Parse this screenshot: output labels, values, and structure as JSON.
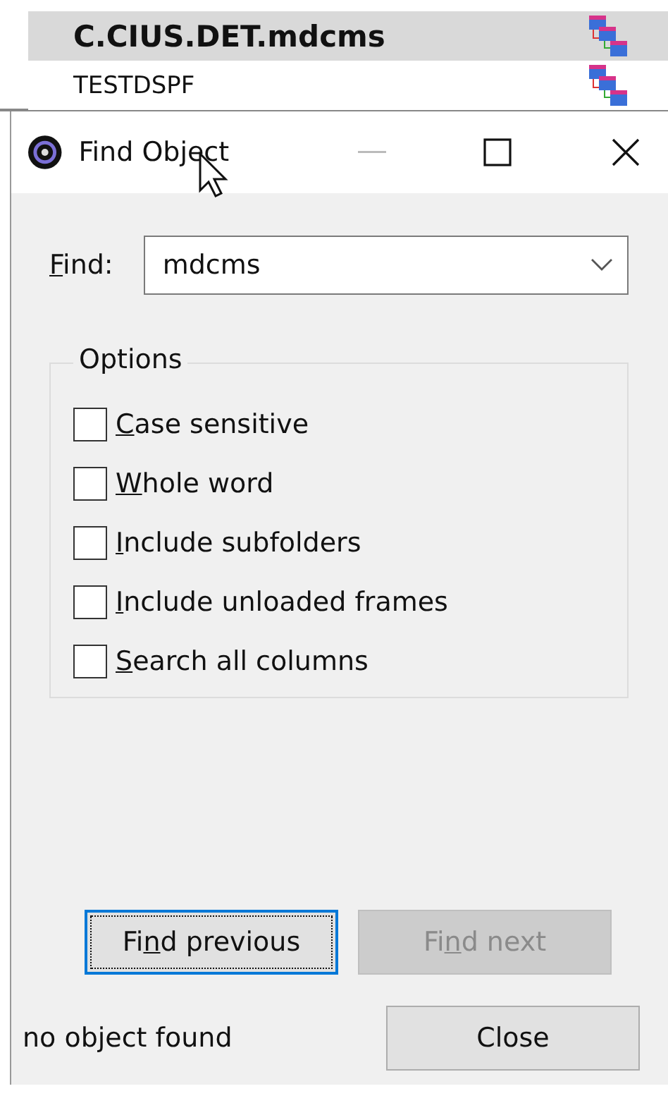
{
  "background_list": {
    "rows": [
      {
        "name": "C.CIUS.DET.mdcms",
        "selected": true
      },
      {
        "name": "TESTDSPF",
        "selected": false
      }
    ]
  },
  "dialog": {
    "title": "Find Object",
    "find": {
      "label": {
        "key": "F",
        "post": "ind:"
      },
      "value": "mdcms"
    },
    "options": {
      "legend": "Options",
      "items": [
        {
          "label": {
            "key": "C",
            "post": "ase sensitive"
          },
          "checked": false
        },
        {
          "label": {
            "key": "W",
            "post": "hole word"
          },
          "checked": false
        },
        {
          "label": {
            "key": "I",
            "post": "nclude subfolders"
          },
          "checked": false
        },
        {
          "label": {
            "key": "I",
            "post": "nclude unloaded frames"
          },
          "checked": false
        },
        {
          "label": {
            "key": "S",
            "post": "earch all columns"
          },
          "checked": false
        }
      ]
    },
    "buttons": [
      {
        "label": {
          "pre": "Fi",
          "key": "n",
          "post": "d previous"
        },
        "disabled": false,
        "focused": true
      },
      {
        "label": {
          "pre": "Fi",
          "key": "n",
          "post": "d next"
        },
        "disabled": true,
        "focused": false
      }
    ],
    "status": "no object found",
    "close_button": "Close"
  }
}
